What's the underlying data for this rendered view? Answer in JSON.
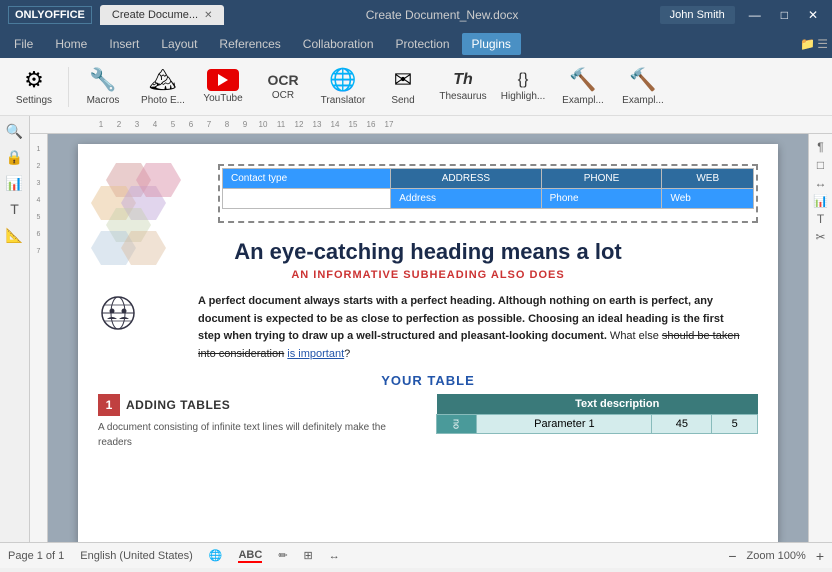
{
  "titlebar": {
    "app_name": "ONLYOFFICE",
    "tab_title": "Create Docume...",
    "doc_title": "Create Document_New.docx",
    "user": "John Smith",
    "minimize": "—",
    "maximize": "□",
    "close": "✕"
  },
  "menubar": {
    "items": [
      "File",
      "Home",
      "Insert",
      "Layout",
      "References",
      "Collaboration",
      "Protection",
      "Plugins"
    ],
    "active": "Plugins"
  },
  "toolbar": {
    "buttons": [
      {
        "id": "settings",
        "label": "Settings",
        "icon": "⚙"
      },
      {
        "id": "macros",
        "label": "Macros",
        "icon": "🔧"
      },
      {
        "id": "photo-editor",
        "label": "Photo E...",
        "icon": "🖼"
      },
      {
        "id": "youtube",
        "label": "YouTube",
        "icon": "yt"
      },
      {
        "id": "ocr",
        "label": "OCR",
        "icon": "📄"
      },
      {
        "id": "translator",
        "label": "Translator",
        "icon": "🌐"
      },
      {
        "id": "send",
        "label": "Send",
        "icon": "✉"
      },
      {
        "id": "thesaurus",
        "label": "Thesaurus",
        "icon": "Th"
      },
      {
        "id": "highlight",
        "label": "Highligh...",
        "icon": "{}"
      },
      {
        "id": "example1",
        "label": "Exampl...",
        "icon": "🔨"
      },
      {
        "id": "example2",
        "label": "Exampl...",
        "icon": "🔨"
      }
    ]
  },
  "document": {
    "heading": "An eye-catching heading means a lot",
    "subheading": "AN INFORMATIVE SUBHEADING ALSO DOES",
    "body_text": "A perfect document always starts with a perfect heading. Although nothing on earth is perfect, any document is expected to be as close to perfection as possible. Choosing an ideal heading is the first step when trying to draw up a well-structured and pleasant-looking document. What else should be taken into consideration is important?",
    "your_table_label": "YOUR TABLE",
    "contact_table": {
      "contact_type": "Contact type",
      "address_header": "ADDRESS",
      "phone_header": "PHONE",
      "web_header": "WEB",
      "address_field": "Address",
      "phone_field": "Phone",
      "web_field": "Web"
    },
    "section": {
      "number": "1",
      "title": "ADDING TABLES",
      "body": "A document consisting of infinite text lines will definitely make the readers"
    },
    "data_table": {
      "header": "Text description",
      "row_header": "no",
      "param1": "Parameter 1",
      "val1": "45",
      "val2": "5"
    }
  },
  "statusbar": {
    "page": "Page 1 of 1",
    "language": "English (United States)",
    "zoom": "Zoom 100%"
  },
  "sidebar_icons": [
    "🔍",
    "🔒",
    "📊",
    "🔤",
    "📐"
  ],
  "right_sidebar_icons": [
    "¶",
    "□",
    "↔",
    "📊",
    "T↔",
    "✂"
  ]
}
